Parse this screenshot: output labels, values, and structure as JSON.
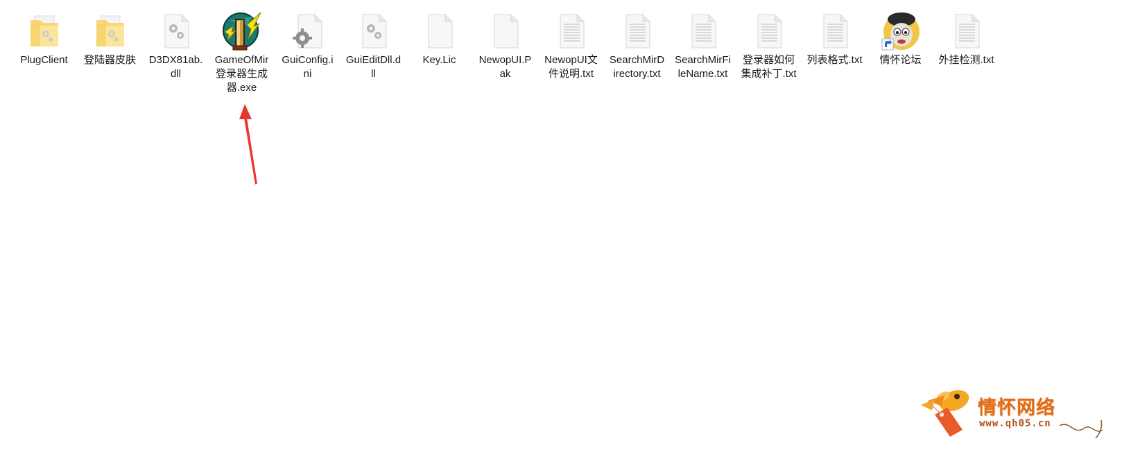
{
  "desktop": {
    "files": [
      {
        "name": "PlugClient",
        "icon": "folder-icon"
      },
      {
        "name": "登陆器皮肤",
        "icon": "folder-icon"
      },
      {
        "name": "D3DX81ab.dll",
        "icon": "dll-file-icon"
      },
      {
        "name": "GameOfMir登录器生成器.exe",
        "icon": "exe-app-icon"
      },
      {
        "name": "GuiConfig.ini",
        "icon": "config-file-icon"
      },
      {
        "name": "GuiEditDll.dll",
        "icon": "dll-file-icon"
      },
      {
        "name": "Key.Lic",
        "icon": "blank-file-icon"
      },
      {
        "name": "NewopUI.Pak",
        "icon": "blank-file-icon"
      },
      {
        "name": "NewopUI文件说明.txt",
        "icon": "text-file-icon"
      },
      {
        "name": "SearchMirDirectory.txt",
        "icon": "text-file-icon"
      },
      {
        "name": "SearchMirFileName.txt",
        "icon": "text-file-icon"
      },
      {
        "name": "登录器如何集成补丁.txt",
        "icon": "text-file-icon"
      },
      {
        "name": "列表格式.txt",
        "icon": "text-file-icon"
      },
      {
        "name": "情怀论坛",
        "icon": "shortcut-cartoon-icon"
      },
      {
        "name": "外挂检测.txt",
        "icon": "text-file-icon"
      }
    ]
  },
  "annotation": {
    "arrow_color": "#e8372f",
    "icon": "red-arrow-icon"
  },
  "watermark": {
    "title": "情怀网络",
    "url": "www.qh05.cn",
    "color": "#e06a16"
  }
}
